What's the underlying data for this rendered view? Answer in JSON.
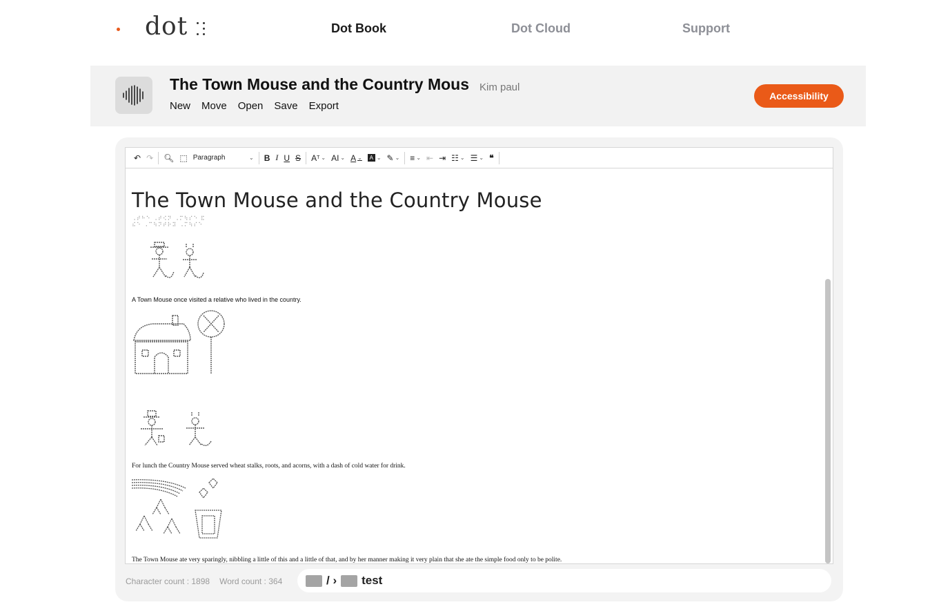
{
  "nav": {
    "logo": "dot",
    "links": [
      "Dot Book",
      "Dot Cloud",
      "Support"
    ],
    "active_index": 0,
    "accent_color": "#ea5a18"
  },
  "doc": {
    "title": "The Town Mouse and the Country Mouse",
    "author": "Kim paul",
    "menu": [
      "New",
      "Move",
      "Open",
      "Save",
      "Export"
    ],
    "accessibility_label": "Accessibility"
  },
  "toolbar": {
    "paragraph_select": "Paragraph",
    "icons": [
      "undo-icon",
      "redo-icon",
      "find-icon",
      "select-all-icon",
      "bold-icon",
      "italic-icon",
      "underline-icon",
      "strikethrough-icon",
      "font-size-icon",
      "font-family-icon",
      "font-color-icon",
      "background-color-icon",
      "highlight-icon",
      "align-icon",
      "outdent-icon",
      "indent-icon",
      "bulleted-list-icon",
      "numbered-list-icon",
      "blockquote-icon"
    ]
  },
  "content": {
    "heading": "The Town Mouse and the Country Mouse",
    "braille_line1": "⠠⠞⠓⠑ ⠠⠞⠪⠝ ⠠⠍⠳⠎⠑ ⠯",
    "braille_line2": "⠮⠑ ⠠⠉⠳⠝⠞⠗⠽ ⠠⠍⠳⠎⠑",
    "p1": "A Town Mouse once visited a relative who lived in the country.",
    "p2": "For lunch the Country Mouse served wheat stalks, roots, and acorns, with a dash of cold water for drink.",
    "p3": "The Town Mouse ate very sparingly, nibbling a little of this and a little of that, and by her manner making it very plain that she ate the simple food only to be polite."
  },
  "status": {
    "character_count": "Character count : 1898",
    "word_count": "Word count : 364",
    "path_separator": "/ ›",
    "folder_name": "test"
  }
}
